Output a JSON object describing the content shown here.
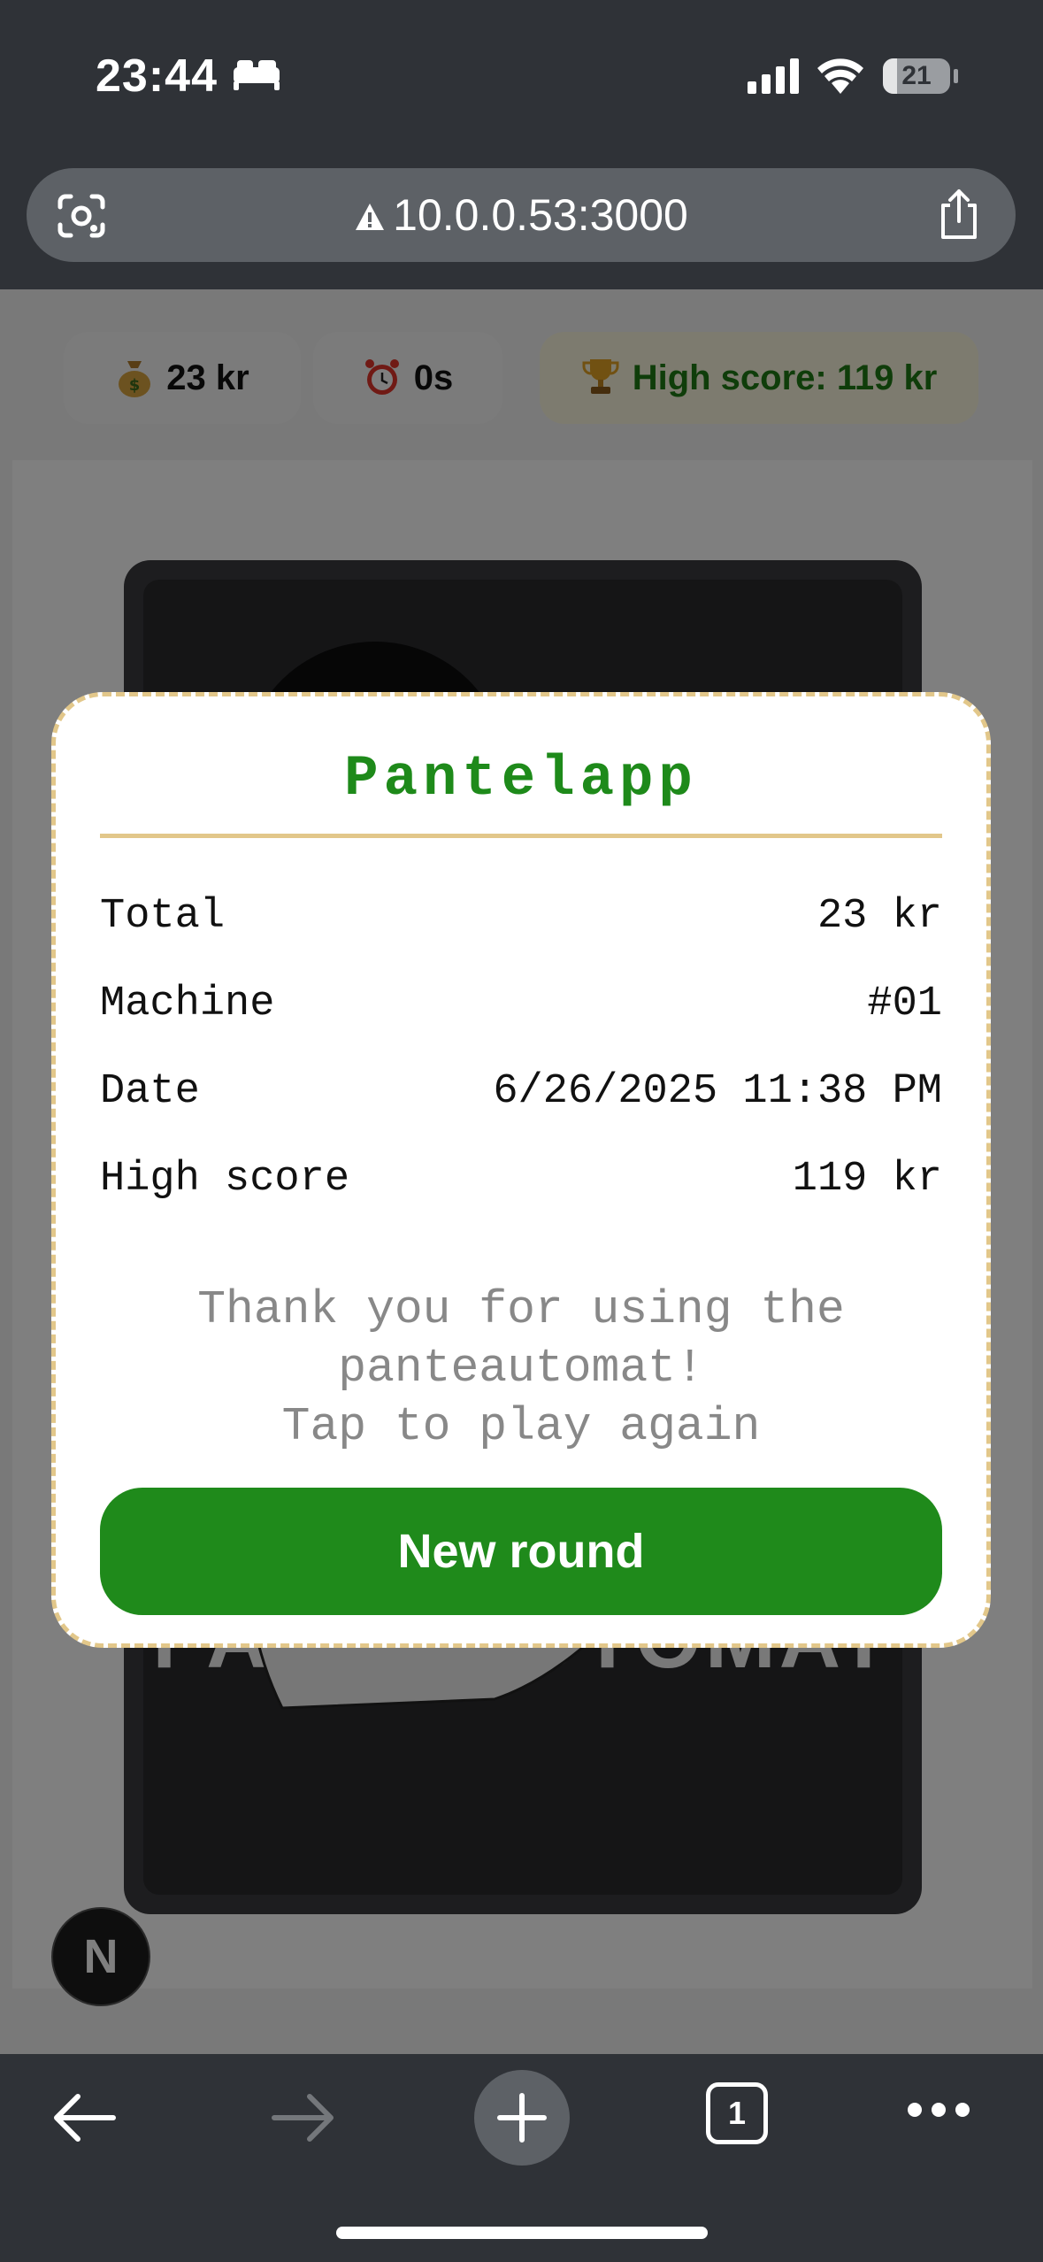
{
  "status_bar": {
    "time": "23:44",
    "battery": "21"
  },
  "browser": {
    "url": "10.0.0.53:3000"
  },
  "hud": {
    "money": "23 kr",
    "timer": "0s",
    "high_score": "High score: 119 kr"
  },
  "machine": {
    "label": "PANTEAUTOMAT"
  },
  "receipt": {
    "title": "Pantelapp",
    "rows": [
      {
        "label": "Total",
        "value": "23 kr"
      },
      {
        "label": "Machine",
        "value": "#01"
      },
      {
        "label": "Date",
        "value": "6/26/2025 11:38 PM"
      },
      {
        "label": "High score",
        "value": "119 kr"
      }
    ],
    "thanks_line1": "Thank you for using the",
    "thanks_line2": "panteautomat!",
    "thanks_line3": "Tap to play again",
    "button": "New round"
  },
  "toolbar": {
    "tabs_count": "1"
  },
  "dev_badge": "N"
}
